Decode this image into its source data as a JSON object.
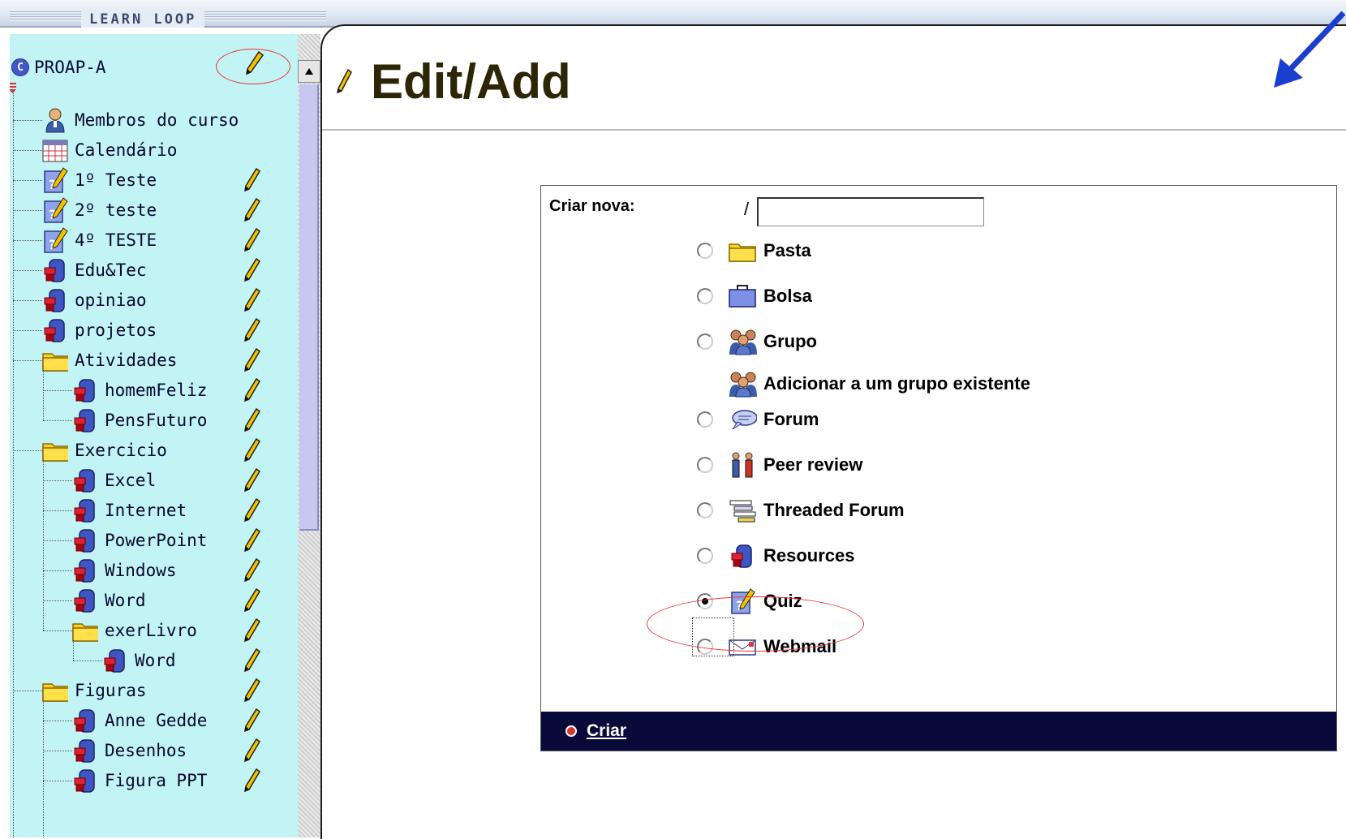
{
  "app": {
    "brand": "LEARN LOOP"
  },
  "sidebar": {
    "root_label": "PROAP-A",
    "root_badge": "C",
    "items": [
      {
        "label": "Membros do curso",
        "icon": "person-icon",
        "level": 0,
        "pencil": false
      },
      {
        "label": "Calendário",
        "icon": "calendar-icon",
        "level": 0,
        "pencil": false
      },
      {
        "label": "1º Teste",
        "icon": "quiz-icon",
        "level": 0,
        "pencil": true
      },
      {
        "label": "2º teste",
        "icon": "quiz-icon",
        "level": 0,
        "pencil": true
      },
      {
        "label": "4º TESTE",
        "icon": "quiz-icon",
        "level": 0,
        "pencil": true
      },
      {
        "label": "Edu&Tec",
        "icon": "resource-icon",
        "level": 0,
        "pencil": true
      },
      {
        "label": "opiniao",
        "icon": "resource-icon",
        "level": 0,
        "pencil": true
      },
      {
        "label": "projetos",
        "icon": "resource-icon",
        "level": 0,
        "pencil": true
      },
      {
        "label": "Atividades",
        "icon": "folder-icon",
        "level": 0,
        "pencil": true
      },
      {
        "label": "homemFeliz",
        "icon": "resource-icon",
        "level": 1,
        "pencil": true
      },
      {
        "label": "PensFuturo",
        "icon": "resource-icon",
        "level": 1,
        "pencil": true
      },
      {
        "label": "Exercicio",
        "icon": "folder-icon",
        "level": 0,
        "pencil": true
      },
      {
        "label": "Excel",
        "icon": "resource-icon",
        "level": 1,
        "pencil": true
      },
      {
        "label": "Internet",
        "icon": "resource-icon",
        "level": 1,
        "pencil": true
      },
      {
        "label": "PowerPoint",
        "icon": "resource-icon",
        "level": 1,
        "pencil": true
      },
      {
        "label": "Windows",
        "icon": "resource-icon",
        "level": 1,
        "pencil": true
      },
      {
        "label": "Word",
        "icon": "resource-icon",
        "level": 1,
        "pencil": true
      },
      {
        "label": "exerLivro",
        "icon": "folder-icon",
        "level": 1,
        "pencil": true
      },
      {
        "label": "Word",
        "icon": "resource-icon",
        "level": 2,
        "pencil": true
      },
      {
        "label": "Figuras",
        "icon": "folder-icon",
        "level": 0,
        "pencil": true
      },
      {
        "label": "Anne Gedde",
        "icon": "resource-icon",
        "level": 1,
        "pencil": true
      },
      {
        "label": "Desenhos",
        "icon": "resource-icon",
        "level": 1,
        "pencil": true
      },
      {
        "label": "Figura PPT",
        "icon": "resource-icon",
        "level": 1,
        "pencil": true
      }
    ]
  },
  "main": {
    "title": "Edit/Add",
    "form": {
      "new_label": "Criar nova:",
      "path_prefix": "/",
      "name_value": "",
      "submit_label": "Criar",
      "options": [
        {
          "label": "Pasta",
          "icon": "folder-icon",
          "radio": true,
          "checked": false
        },
        {
          "label": "Bolsa",
          "icon": "briefcase-icon",
          "radio": true,
          "checked": false
        },
        {
          "label": "Grupo",
          "icon": "group-icon",
          "radio": true,
          "checked": false
        },
        {
          "label": "Adicionar a um grupo existente",
          "icon": "group-icon",
          "radio": false,
          "checked": false
        },
        {
          "label": "Forum",
          "icon": "speech-bubble-icon",
          "radio": true,
          "checked": false
        },
        {
          "label": "Peer review",
          "icon": "peer-review-icon",
          "radio": true,
          "checked": false
        },
        {
          "label": "Threaded Forum",
          "icon": "threaded-forum-icon",
          "radio": true,
          "checked": false
        },
        {
          "label": "Resources",
          "icon": "resource-icon",
          "radio": true,
          "checked": false
        },
        {
          "label": "Quiz",
          "icon": "quiz-icon",
          "radio": true,
          "checked": true
        },
        {
          "label": "Webmail",
          "icon": "webmail-icon",
          "radio": true,
          "checked": false
        }
      ]
    }
  },
  "colors": {
    "sidebar_bg": "#c2f4f6",
    "footer_bg": "#0a0a3a",
    "annotation_red": "#e33333",
    "annotation_arrow": "#1a3ecf"
  }
}
